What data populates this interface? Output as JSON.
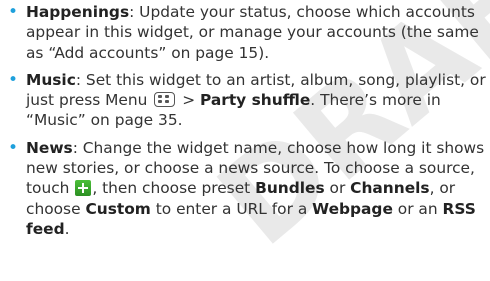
{
  "watermark_text": "DRAFT",
  "items": [
    {
      "term": "Happenings",
      "text": ": Update your status, choose which accounts appear in this widget, or manage your accounts (the same as “Add accounts” on page 15)."
    },
    {
      "term": "Music",
      "text1": ": Set this widget to an artist, album, song, playlist, or just press Menu",
      "menu_icon": "menu-key-icon",
      "text2": " > ",
      "action": "Party shuffle",
      "text3": ". There’s more in “Music” on page 35."
    },
    {
      "term": "News",
      "text1": ": Change the widget name, choose how long it shows new stories, or choose a news source. To choose a source, touch",
      "add_icon": "add-icon",
      "text2": ", then choose preset ",
      "bundles": "Bundles",
      "text3": " or ",
      "channels": "Channels",
      "text4": ", or choose ",
      "custom": "Custom",
      "text5": " to enter a URL for a ",
      "webpage": "Webpage",
      "text6": " or an ",
      "rss": "RSS feed",
      "text7": "."
    }
  ],
  "colors": {
    "bullet": "#1ea0dc",
    "text": "#333333",
    "watermark": "#e9e9e9"
  }
}
